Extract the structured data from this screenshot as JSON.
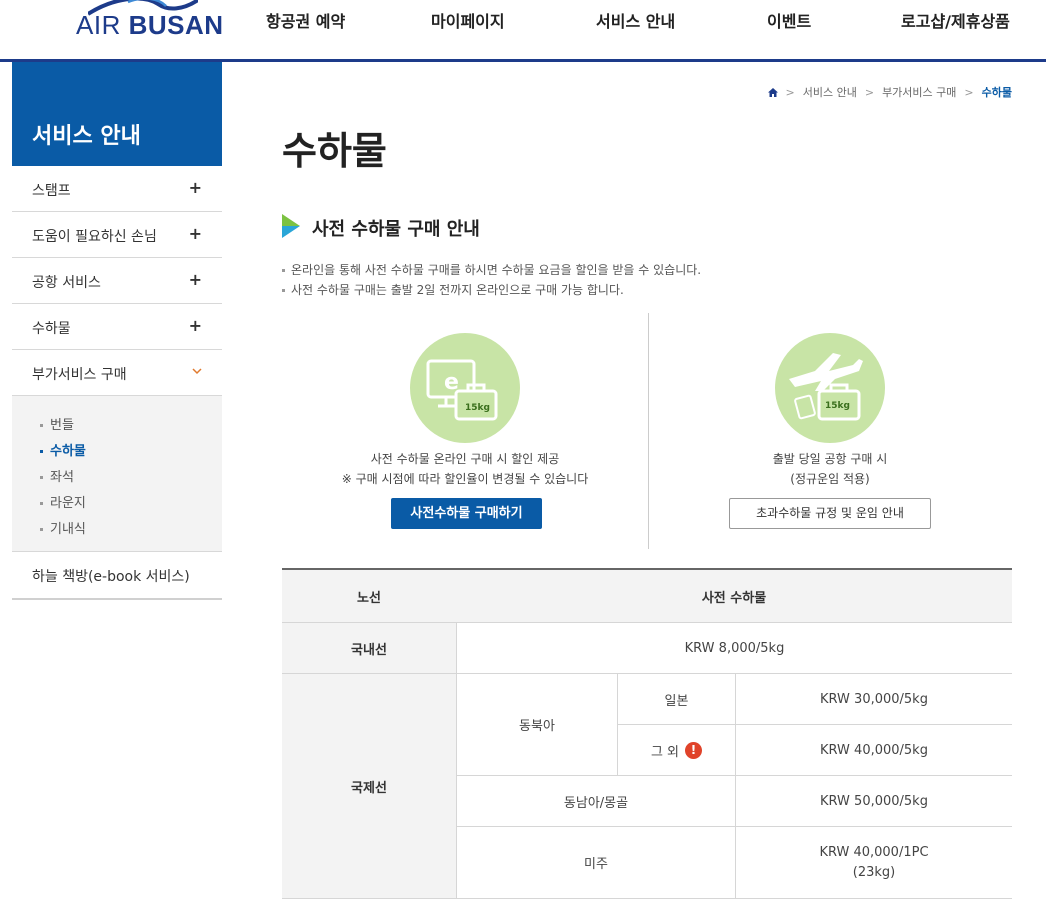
{
  "brand": "AIR BUSAN",
  "nav": [
    "항공권 예약",
    "마이페이지",
    "서비스 안내",
    "이벤트",
    "로고샵/제휴상품"
  ],
  "sidebar": {
    "title": "서비스 안내",
    "items": [
      {
        "label": "스탬프",
        "toggle": "+"
      },
      {
        "label": "도움이 필요하신 손님",
        "toggle": "+"
      },
      {
        "label": "공항 서비스",
        "toggle": "+"
      },
      {
        "label": "수하물",
        "toggle": "+"
      }
    ],
    "open": {
      "label": "부가서비스 구매",
      "sub": [
        {
          "label": "번들",
          "active": false
        },
        {
          "label": "수하물",
          "active": true
        },
        {
          "label": "좌석",
          "active": false
        },
        {
          "label": "라운지",
          "active": false
        },
        {
          "label": "기내식",
          "active": false
        }
      ]
    },
    "last": "하늘 책방(e-book 서비스)"
  },
  "breadcrumb": [
    "서비스 안내",
    "부가서비스 구매",
    "수하물"
  ],
  "page_title": "수하물",
  "section_title": "사전 수하물 구매 안내",
  "notes": [
    "온라인을 통해 사전 수하물 구매를 하시면 수하물 요금을 할인을 받을 수 있습니다.",
    "사전 수하물 구매는 출발 2일 전까지 온라인으로 구매 가능 합니다."
  ],
  "cards": [
    {
      "badge": "15kg",
      "line1": "사전 수하물 온라인 구매 시 할인 제공",
      "line2": "※ 구매 시점에 따라 할인율이 변경될 수 있습니다",
      "button": "사전수하물 구매하기"
    },
    {
      "badge": "15kg",
      "line1": "출발 당일 공항 구매 시",
      "line2": "(정규운임 적용)",
      "button": "초과수하물 규정 및 운임 안내"
    }
  ],
  "table": {
    "head": [
      "노선",
      "사전 수하물"
    ],
    "domestic": {
      "label": "국내선",
      "price": "KRW 8,000/5kg"
    },
    "intl": {
      "label": "국제선",
      "northeast": "동북아",
      "japan": "일본",
      "japan_price": "KRW 30,000/5kg",
      "other": "그 외",
      "other_price": "KRW 40,000/5kg",
      "sea": "동남아/몽골",
      "sea_price": "KRW 50,000/5kg",
      "us": "미주",
      "us_price_1": "KRW 40,000/1PC",
      "us_price_2": "(23kg)"
    }
  },
  "colors": {
    "brand_blue": "#0a5ba6",
    "navy": "#1d3b8a",
    "green_circle": "#c8e4a6",
    "alert_red": "#e0432a",
    "chevron_orange": "#e07a2e"
  }
}
